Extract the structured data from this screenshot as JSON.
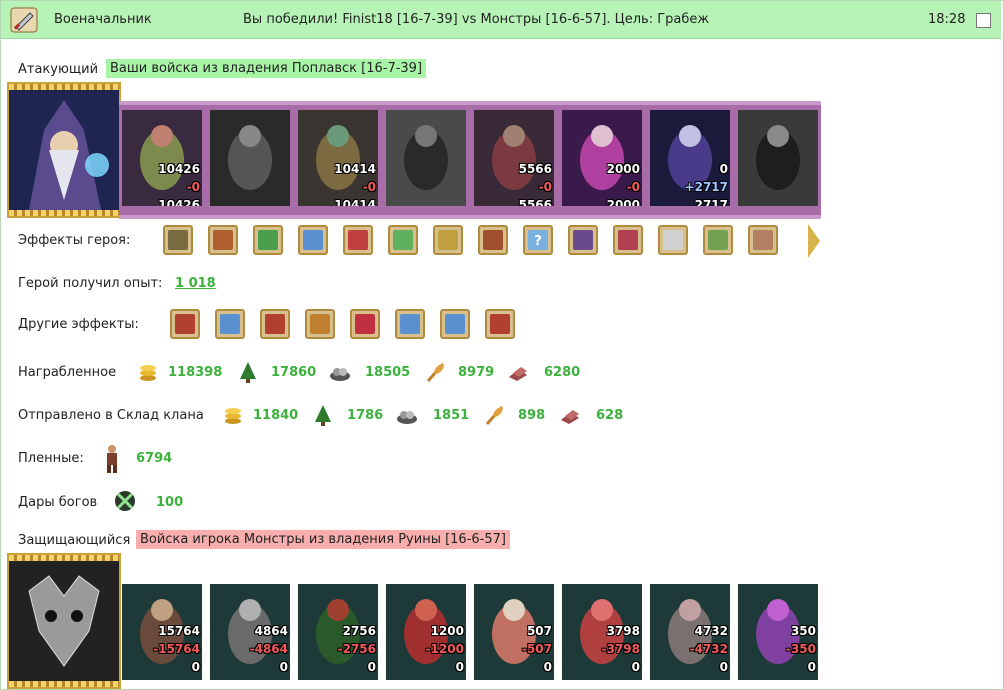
{
  "header": {
    "title": "Военачальник",
    "battle_text": "Вы победили! Finist18 [16-7-39] vs Монстры [16-6-57]. Цель: Грабеж",
    "time": "18:28"
  },
  "attacker": {
    "label": "Атакующий",
    "tag": "Ваши войска из владения Поплавск [16-7-39]",
    "units": [
      {
        "start": "10426",
        "loss": "-0",
        "end": "10426"
      },
      {
        "start": "",
        "loss": "",
        "end": ""
      },
      {
        "start": "10414",
        "loss": "-0",
        "end": "10414"
      },
      {
        "start": "",
        "loss": "",
        "end": ""
      },
      {
        "start": "5566",
        "loss": "-0",
        "end": "5566"
      },
      {
        "start": "2000",
        "loss": "-0",
        "end": "2000"
      },
      {
        "start": "0",
        "loss": "+2717",
        "end": "2717"
      },
      {
        "start": "",
        "loss": "",
        "end": ""
      }
    ]
  },
  "hero_effects_label": "Эффекты героя:",
  "hero_exp": {
    "label": "Герой получил опыт:",
    "value": "1 018"
  },
  "other_effects_label": "Другие эффекты:",
  "loot": {
    "label": "Награбленное",
    "values": [
      "118398",
      "17860",
      "18505",
      "8979",
      "6280"
    ]
  },
  "clan": {
    "label": "Отправлено в Склад клана",
    "values": [
      "11840",
      "1786",
      "1851",
      "898",
      "628"
    ]
  },
  "prisoners": {
    "label": "Пленные:",
    "value": "6794"
  },
  "gifts": {
    "label": "Дары богов",
    "value": "100"
  },
  "defender": {
    "label": "Защищающийся",
    "tag": "Войска игрока Монстры из владения Руины [16-6-57]",
    "units": [
      {
        "start": "15764",
        "loss": "-15764",
        "end": "0"
      },
      {
        "start": "4864",
        "loss": "-4864",
        "end": "0"
      },
      {
        "start": "2756",
        "loss": "-2756",
        "end": "0"
      },
      {
        "start": "1200",
        "loss": "-1200",
        "end": "0"
      },
      {
        "start": "507",
        "loss": "-507",
        "end": "0"
      },
      {
        "start": "3798",
        "loss": "-3798",
        "end": "0"
      },
      {
        "start": "4732",
        "loss": "-4732",
        "end": "0"
      },
      {
        "start": "350",
        "loss": "-350",
        "end": "0"
      }
    ]
  },
  "resource_icons": [
    "gold-coins-icon",
    "wood-tree-icon",
    "stone-ore-icon",
    "wheat-icon",
    "brick-icon"
  ],
  "colors": {
    "header_bg": "#b7f3b7",
    "positive": "#3cb13c",
    "loss": "#f45a5a",
    "attacker_tag": "#a8f5a8",
    "defender_tag": "#f9aeae"
  }
}
